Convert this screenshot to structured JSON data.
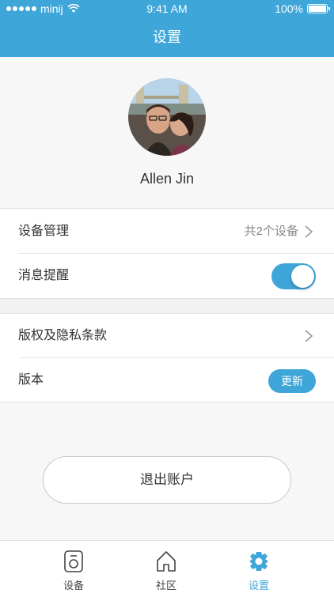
{
  "status_bar": {
    "carrier": "minij",
    "time": "9:41 AM",
    "battery": "100%",
    "signal_icon": "signal-dots-icon",
    "wifi_icon": "wifi-icon",
    "battery_icon": "battery-icon"
  },
  "nav": {
    "title": "设置"
  },
  "profile": {
    "name": "Allen Jin",
    "avatar_icon": "avatar-photo"
  },
  "settings": {
    "device_management": {
      "label": "设备管理",
      "value": "共2个设备"
    },
    "notifications": {
      "label": "消息提醒",
      "enabled": true
    },
    "copyright": {
      "label": "版权及隐私条款"
    },
    "version": {
      "label": "版本",
      "button": "更新"
    }
  },
  "logout": {
    "label": "退出账户"
  },
  "tabs": [
    {
      "label": "设备",
      "icon": "device-icon",
      "active": false
    },
    {
      "label": "社区",
      "icon": "home-icon",
      "active": false
    },
    {
      "label": "设置",
      "icon": "gear-icon",
      "active": true
    }
  ],
  "colors": {
    "accent": "#3ea6d8",
    "background": "#f7f7f7"
  }
}
